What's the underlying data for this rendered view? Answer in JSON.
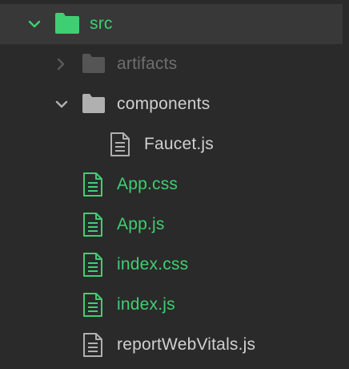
{
  "colors": {
    "background": "#2a2a2a",
    "selected_row": "#383838",
    "green": "#3ecf73",
    "muted": "#8a8a8a",
    "text": "#d0d0d0",
    "gray_icon": "#b0b0b0"
  },
  "tree": {
    "root": {
      "label": "src",
      "icon": "folder-icon",
      "expanded": true,
      "state": "added"
    },
    "artifacts": {
      "label": "artifacts",
      "icon": "folder-icon",
      "expanded": false,
      "state": "ignored"
    },
    "components": {
      "label": "components",
      "icon": "folder-icon",
      "expanded": true,
      "state": "normal"
    },
    "faucet": {
      "label": "Faucet.js",
      "icon": "file-icon",
      "state": "normal"
    },
    "app_css": {
      "label": "App.css",
      "icon": "file-icon",
      "state": "added"
    },
    "app_js": {
      "label": "App.js",
      "icon": "file-icon",
      "state": "added"
    },
    "index_css": {
      "label": "index.css",
      "icon": "file-icon",
      "state": "added"
    },
    "index_js": {
      "label": "index.js",
      "icon": "file-icon",
      "state": "added"
    },
    "report": {
      "label": "reportWebVitals.js",
      "icon": "file-icon",
      "state": "normal"
    }
  }
}
